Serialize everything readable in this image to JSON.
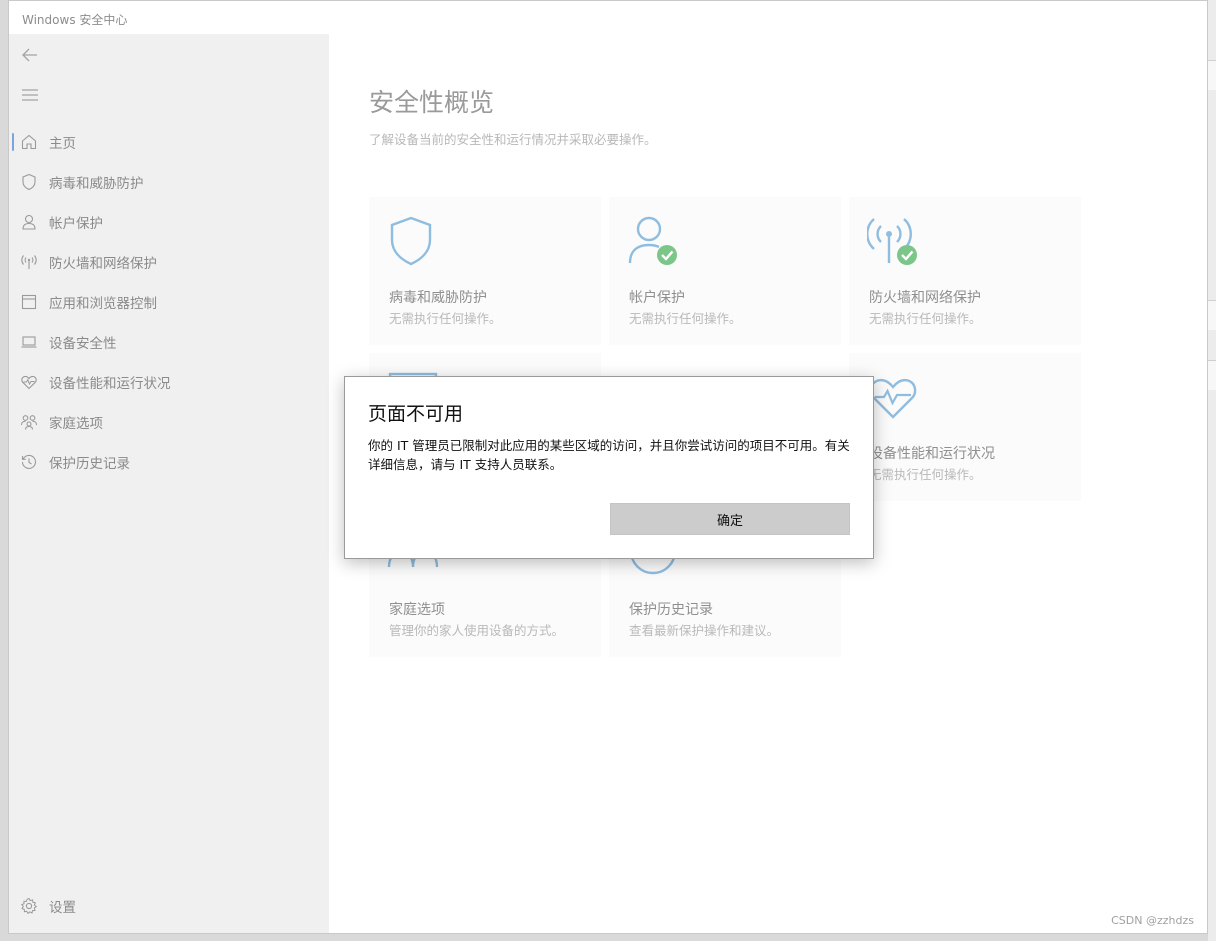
{
  "window": {
    "title": "Windows 安全中心"
  },
  "sidebar": {
    "items": [
      {
        "label": "主页",
        "icon": "home-icon",
        "active": true
      },
      {
        "label": "病毒和威胁防护",
        "icon": "shield-icon"
      },
      {
        "label": "帐户保护",
        "icon": "person-icon"
      },
      {
        "label": "防火墙和网络保护",
        "icon": "antenna-icon"
      },
      {
        "label": "应用和浏览器控制",
        "icon": "app-window-icon"
      },
      {
        "label": "设备安全性",
        "icon": "laptop-icon"
      },
      {
        "label": "设备性能和运行状况",
        "icon": "heart-pulse-icon"
      },
      {
        "label": "家庭选项",
        "icon": "family-icon"
      },
      {
        "label": "保护历史记录",
        "icon": "history-icon"
      }
    ],
    "settings_label": "设置"
  },
  "main": {
    "title": "安全性概览",
    "subtitle": "了解设备当前的安全性和运行情况并采取必要操作。",
    "cards": [
      {
        "title": "病毒和威胁防护",
        "desc": "无需执行任何操作。",
        "icon": "shield-icon"
      },
      {
        "title": "帐户保护",
        "desc": "无需执行任何操作。",
        "icon": "person-check-icon"
      },
      {
        "title": "防火墙和网络保护",
        "desc": "无需执行任何操作。",
        "icon": "antenna-check-icon"
      },
      {
        "title": "设备性能和运行状况",
        "desc": "无需执行任何操作。",
        "icon": "heart-pulse-icon"
      },
      {
        "title": "家庭选项",
        "desc": "管理你的家人使用设备的方式。",
        "icon": "family-icon"
      },
      {
        "title": "保护历史记录",
        "desc": "查看最新保护操作和建议。",
        "icon": "history-icon"
      }
    ]
  },
  "dialog": {
    "title": "页面不可用",
    "message": "你的 IT 管理员已限制对此应用的某些区域的访问，并且你尝试访问的项目不可用。有关详细信息，请与 IT 支持人员联系。",
    "ok_label": "确定"
  },
  "watermark": "CSDN @zzhdzs",
  "colors": {
    "accent": "#7aa6d9",
    "icon_blue": "#8fbde0",
    "check_green": "#7cc68a"
  }
}
